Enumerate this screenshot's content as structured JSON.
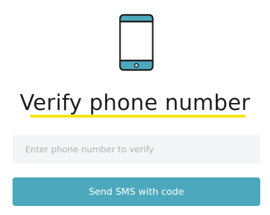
{
  "header": {
    "illustration_icon": "smartphone-icon",
    "title": "Verify phone number"
  },
  "form": {
    "phone_input": {
      "value": "",
      "placeholder": "Enter phone number to verify"
    },
    "send_button_label": "Send SMS with code"
  },
  "colors": {
    "accent": "#4ca8bd",
    "underline": "#f6e500",
    "input_bg": "#f4f5f6",
    "text": "#1f1f1f",
    "placeholder": "#aeb3b7"
  }
}
